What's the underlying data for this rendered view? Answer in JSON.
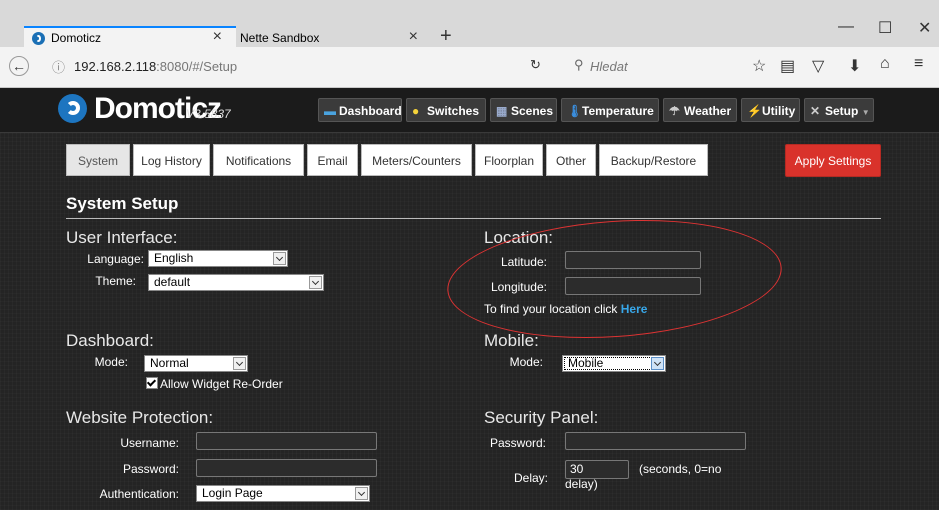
{
  "browser": {
    "tabs": [
      {
        "title": "Domoticz",
        "close": "×"
      },
      {
        "title": "Nette Sandbox",
        "close": "×"
      }
    ],
    "new_tab": "+",
    "window": {
      "minimize": "—",
      "maximize": "☐",
      "close": "✕"
    },
    "url_host": "192.168.2.118",
    "url_rest": ":8080/#/Setup",
    "search_placeholder": "Hledat"
  },
  "app": {
    "logo": "Domoticz",
    "version": "V3.5837",
    "menu": [
      {
        "label": "Dashboard",
        "icon": "dashboard-icon"
      },
      {
        "label": "Switches",
        "icon": "lightbulb-icon"
      },
      {
        "label": "Scenes",
        "icon": "scenes-icon"
      },
      {
        "label": "Temperature",
        "icon": "thermometer-icon"
      },
      {
        "label": "Weather",
        "icon": "weather-icon"
      },
      {
        "label": "Utility",
        "icon": "utility-icon"
      },
      {
        "label": "Setup",
        "icon": "tools-icon"
      }
    ],
    "tabs": [
      "System",
      "Log History",
      "Notifications",
      "Email",
      "Meters/Counters",
      "Floorplan",
      "Other",
      "Backup/Restore"
    ],
    "apply": "Apply Settings",
    "title": "System Setup",
    "ui": {
      "heading": "User Interface:",
      "language_label": "Language:",
      "language_value": "English",
      "theme_label": "Theme:",
      "theme_value": "default"
    },
    "location": {
      "heading": "Location:",
      "lat_label": "Latitude:",
      "lon_label": "Longitude:",
      "hint": "To find your location click ",
      "hint_link": "Here"
    },
    "dashboard": {
      "heading": "Dashboard:",
      "mode_label": "Mode:",
      "mode_value": "Normal",
      "reorder_label": "Allow Widget Re-Order"
    },
    "mobile": {
      "heading": "Mobile:",
      "mode_label": "Mode:",
      "mode_value": "Mobile"
    },
    "website": {
      "heading": "Website Protection:",
      "user_label": "Username:",
      "pass_label": "Password:",
      "auth_label": "Authentication:",
      "auth_value": "Login Page"
    },
    "security": {
      "heading": "Security Panel:",
      "pass_label": "Password:",
      "delay_label": "Delay:",
      "delay_value": "30",
      "delay_hint": "(seconds, 0=no delay)"
    }
  }
}
